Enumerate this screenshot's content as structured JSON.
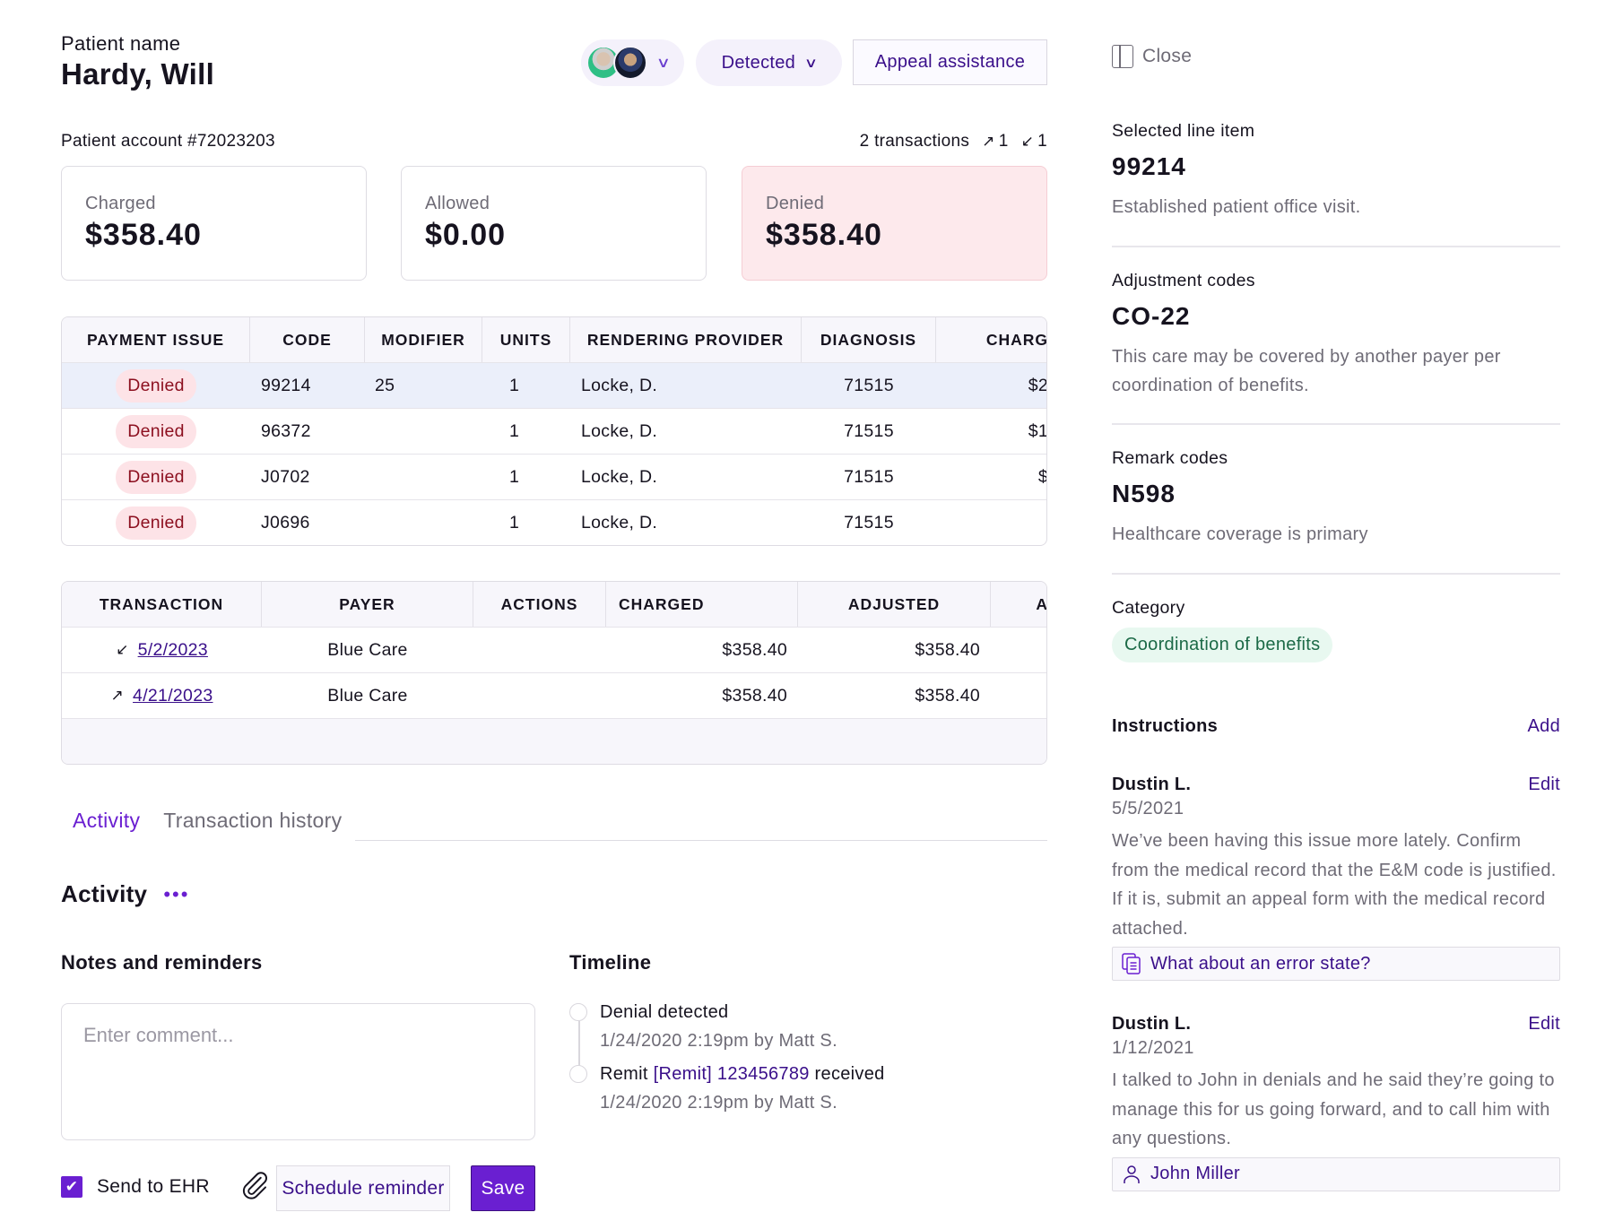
{
  "header": {
    "patient_name_label": "Patient name",
    "patient_name": "Hardy, Will",
    "assignees_chevron": "⌄",
    "status": "Detected",
    "status_chevron": "⌄",
    "appeal_button": "Appeal assistance",
    "account": "Patient account #72023203",
    "transactions_count": "2 transactions",
    "outgoing_icon": "↗",
    "outgoing_count": "1",
    "incoming_icon": "↙",
    "incoming_count": "1"
  },
  "summary": [
    {
      "label": "Charged",
      "value": "$358.40"
    },
    {
      "label": "Allowed",
      "value": "$0.00"
    },
    {
      "label": "Denied",
      "value": "$358.40"
    }
  ],
  "line_items": {
    "columns": [
      "PAYMENT ISSUE",
      "CODE",
      "MODIFIER",
      "UNITS",
      "RENDERING PROVIDER",
      "DIAGNOSIS",
      "CHARG"
    ],
    "rows": [
      {
        "issue": "Denied",
        "code": "99214",
        "modifier": "25",
        "units": "1",
        "provider": "Locke, D.",
        "diagnosis": "71515",
        "charged": "$2",
        "selected": true
      },
      {
        "issue": "Denied",
        "code": "96372",
        "modifier": "",
        "units": "1",
        "provider": "Locke, D.",
        "diagnosis": "71515",
        "charged": "$1",
        "selected": false
      },
      {
        "issue": "Denied",
        "code": "J0702",
        "modifier": "",
        "units": "1",
        "provider": "Locke, D.",
        "diagnosis": "71515",
        "charged": "$",
        "selected": false
      },
      {
        "issue": "Denied",
        "code": "J0696",
        "modifier": "",
        "units": "1",
        "provider": "Locke, D.",
        "diagnosis": "71515",
        "charged": "",
        "selected": false
      }
    ]
  },
  "transactions": {
    "columns": [
      "TRANSACTION",
      "PAYER",
      "ACTIONS",
      "CHARGED",
      "ADJUSTED",
      "A"
    ],
    "rows": [
      {
        "direction_icon": "↙",
        "date": "5/2/2023",
        "payer": "Blue Care",
        "actions": "",
        "charged": "$358.40",
        "adjusted": "$358.40"
      },
      {
        "direction_icon": "↗",
        "date": "4/21/2023",
        "payer": "Blue Care",
        "actions": "",
        "charged": "$358.40",
        "adjusted": "$358.40"
      }
    ]
  },
  "tabs": [
    {
      "label": "Activity",
      "active": true
    },
    {
      "label": "Transaction history",
      "active": false
    }
  ],
  "activity": {
    "title": "Activity",
    "more_icon": "•••",
    "notes_title": "Notes and reminders",
    "comment_placeholder": "Enter comment...",
    "comment_value": "",
    "send_to_ehr_label": "Send to EHR",
    "send_to_ehr_checked": true,
    "checkmark": "✔",
    "schedule_button": "Schedule reminder",
    "save_button": "Save",
    "timeline_title": "Timeline",
    "timeline": [
      {
        "text_pre": "Denial detected",
        "link": "",
        "text_post": "",
        "meta": "1/24/2020 2:19pm by Matt S."
      },
      {
        "text_pre": "Remit ",
        "link": "[Remit] 123456789",
        "text_post": " received",
        "meta": "1/24/2020 2:19pm by Matt S."
      }
    ]
  },
  "panel": {
    "close_label": "Close",
    "selected_label": "Selected line item",
    "selected_code": "99214",
    "selected_desc": "Established patient office visit.",
    "adjustment_label": "Adjustment codes",
    "adjustment_code": "CO-22",
    "adjustment_desc": "This care may be covered by another payer per coordination of benefits.",
    "remark_label": "Remark codes",
    "remark_code": "N598",
    "remark_desc": "Healthcare coverage is primary",
    "category_label": "Category",
    "category_value": "Coordination of benefits",
    "instructions_title": "Instructions",
    "add_label": "Add",
    "notes": [
      {
        "author": "Dustin L.",
        "date": "5/5/2021",
        "edit": "Edit",
        "body": "We’ve been having this issue more lately. Confirm from the medical record that the E&M code is justified. If it is, submit an appeal form with the medical record attached.",
        "attachment": "What about an error state?"
      },
      {
        "author": "Dustin L.",
        "date": "1/12/2021",
        "edit": "Edit",
        "body": "I talked to John in denials and he said they’re going to manage this for us going forward, and to call him with any questions.",
        "attachment": "John Miller"
      }
    ]
  },
  "colors": {
    "accent": "#6a1fd1",
    "link": "#3a0f8a",
    "denied_bg": "#fde9ec",
    "denied_text": "#8c0f1f",
    "category_bg": "#e8f8f0",
    "category_text": "#1c6a47"
  }
}
